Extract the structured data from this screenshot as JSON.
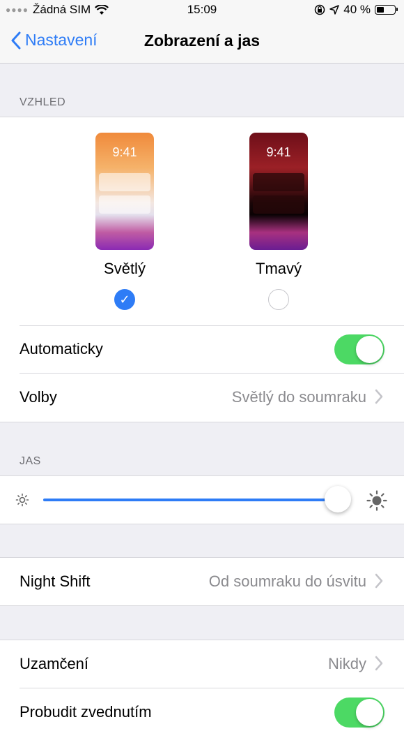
{
  "status_bar": {
    "carrier": "Žádná SIM",
    "time": "15:09",
    "battery_text": "40 %"
  },
  "nav": {
    "back_label": "Nastavení",
    "title": "Zobrazení a jas"
  },
  "appearance": {
    "header": "VZHLED",
    "light": {
      "phone_time": "9:41",
      "label": "Světlý",
      "selected": true
    },
    "dark": {
      "phone_time": "9:41",
      "label": "Tmavý",
      "selected": false
    },
    "automatic": {
      "label": "Automaticky",
      "on": true
    },
    "options": {
      "label": "Volby",
      "value": "Světlý do soumraku"
    }
  },
  "brightness": {
    "header": "JAS",
    "level": 0.95
  },
  "night_shift": {
    "label": "Night Shift",
    "value": "Od soumraku do úsvitu"
  },
  "auto_lock": {
    "label": "Uzamčení",
    "value": "Nikdy"
  },
  "raise_to_wake": {
    "label": "Probudit zvednutím",
    "on": true
  },
  "colors": {
    "accent": "#2e7cf6",
    "toggle_on": "#4cd964"
  }
}
